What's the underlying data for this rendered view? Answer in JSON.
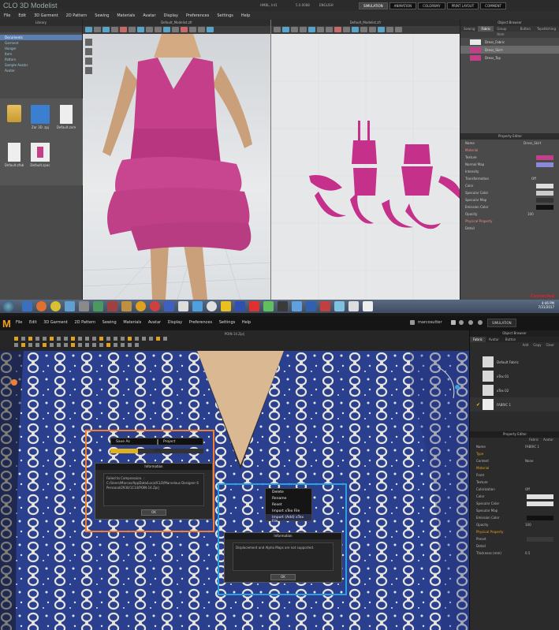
{
  "top": {
    "logo": "CLO 3D Modelist",
    "modes": [
      "SIMULATION",
      "ANIMATION",
      "COLORWAY",
      "PRINT LAYOUT",
      "COMMENT"
    ],
    "menu": [
      "File",
      "Edit",
      "3D Garment",
      "2D Pattern",
      "Sewing",
      "Materials",
      "Avatar",
      "Display",
      "Preferences",
      "Settings",
      "Help"
    ],
    "library": {
      "header": "Library",
      "tree": [
        "Documents",
        "Garment",
        "Hanger",
        "Item",
        "Pattern",
        "Sample Avatar",
        "Avatar"
      ],
      "items": [
        "",
        "Zar 3D .zpj",
        "Default.zxm",
        "Default.zfab",
        "Default.zpac",
        ""
      ]
    },
    "view3d": {
      "header": "Default_Modelist.zfr"
    },
    "view2d": {
      "header": "Default_Modelist.zfr"
    },
    "object_browser": {
      "header": "Object Browser",
      "tabs": [
        "Sewing",
        "Fabric",
        "Group Item",
        "Button",
        "Topstitching"
      ],
      "fabrics": [
        {
          "name": "Dress_Fabric",
          "color": "#e8e8e8"
        },
        {
          "name": "Dress_Skirt",
          "color": "#c43e8a"
        },
        {
          "name": "Dress_Top",
          "color": "#c43e8a"
        }
      ]
    },
    "property_editor": {
      "header": "Property Editor",
      "rows": [
        {
          "label": "Name",
          "value": "Dress_Skirt"
        },
        {
          "label": "Material",
          "section": true
        },
        {
          "label": "Texture",
          "swatch": "#c43e8a"
        },
        {
          "label": "Normal Map",
          "swatch": "#8a8ad8"
        },
        {
          "label": "Intensity"
        },
        {
          "label": "Transformation",
          "value": "Off"
        },
        {
          "label": "Color",
          "swatch": "#dddddd"
        },
        {
          "label": "Specular Color",
          "swatch": "#cccccc"
        },
        {
          "label": "Specular Map",
          "swatch": "#333333"
        },
        {
          "label": "Emission Color",
          "swatch": "#111111"
        },
        {
          "label": "Opacity",
          "value": "100"
        },
        {
          "label": "Physical Property",
          "section": true
        },
        {
          "label": "Detail"
        }
      ]
    },
    "taskbar": {
      "time": "4:46 PM",
      "date": "7/31/2017",
      "brand": "Connected"
    }
  },
  "bottom": {
    "logo": "M",
    "menu": [
      "File",
      "Edit",
      "3D Garment",
      "2D Pattern",
      "Sewing",
      "Materials",
      "Avatar",
      "Display",
      "Preferences",
      "Settings",
      "Help"
    ],
    "user": "marcosutter",
    "mode": "SIMULATION",
    "file_name": "POIN-14.Zprj",
    "object_browser": {
      "header": "Object Browser",
      "tabs": [
        "Fabric",
        "Avatar",
        "Button"
      ],
      "actions": [
        "Add",
        "Copy",
        "Clear"
      ],
      "fabrics": [
        {
          "name": "Default Fabric",
          "color": "#d8d8d8"
        },
        {
          "name": "xTex 01",
          "color": "#d8d8d8"
        },
        {
          "name": "xTex 02",
          "color": "#d8d8d8"
        },
        {
          "name": "FABRIC 1",
          "color": "#e8e8e8"
        }
      ]
    },
    "property_editor": {
      "header": "Property Editor",
      "tabs": [
        "Fabric",
        "Avatar"
      ],
      "rows": [
        {
          "label": "Name",
          "value": "FABRIC 1"
        },
        {
          "label": "Type",
          "section": true
        },
        {
          "label": "Content",
          "value": "None"
        },
        {
          "label": "Material",
          "section": true
        },
        {
          "label": "Front"
        },
        {
          "label": "Texture"
        },
        {
          "label": "Colorization",
          "value": "Off"
        },
        {
          "label": "Color",
          "swatch": "#e0e0e0"
        },
        {
          "label": "Specular Color",
          "swatch": "#e0e0e0"
        },
        {
          "label": "Specular Map"
        },
        {
          "label": "Emission Color",
          "swatch": "#111111"
        },
        {
          "label": "Opacity",
          "value": "100"
        },
        {
          "label": "Physical Property",
          "section": true
        },
        {
          "label": "Preset"
        },
        {
          "label": "Detail"
        },
        {
          "label": "Thickness (mm)",
          "value": "0.5"
        }
      ]
    },
    "save_dialog": {
      "fields": [
        "Save As",
        "Project"
      ],
      "progress": "30%",
      "title": "Information",
      "message": "Failed to Compression. : C:/Users/Marcos/AppData/Local/CLO/Marvelous Designer 6 Personal/2930/1114/POIN-14.Zprj",
      "ok": "OK"
    },
    "context_menu": [
      "Delete",
      "Rename",
      "Reset",
      "Import xTex File",
      "Import (Add) xTex File"
    ],
    "info_dialog": {
      "title": "Information",
      "message": "Displacement and Alpha Maps are not supported.",
      "ok": "OK"
    }
  }
}
